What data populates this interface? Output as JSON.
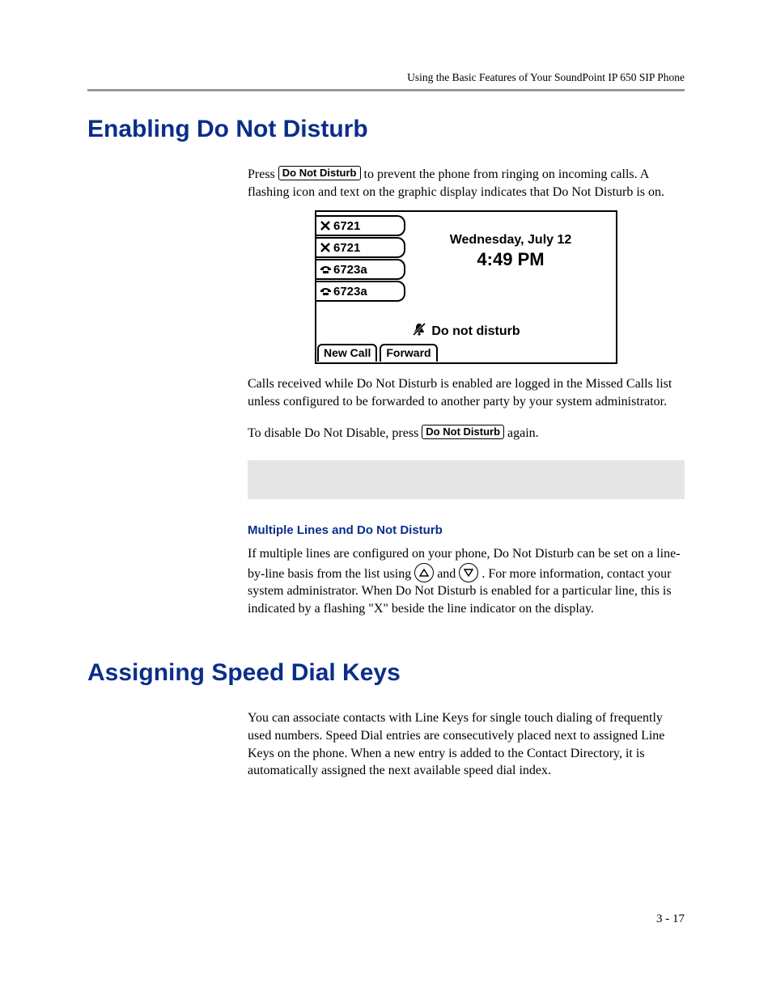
{
  "running_head": "Using the Basic Features of Your SoundPoint IP 650 SIP Phone",
  "section1": {
    "title": "Enabling Do Not Disturb",
    "p1a": "Press ",
    "key1": "Do Not Disturb",
    "p1b": " to prevent the phone from ringing on incoming calls. A flashing icon and text on the graphic display indicates that Do Not Disturb is on.",
    "p2": "Calls received while Do Not Disturb is enabled are logged in the Missed Calls list unless configured to be forwarded to another party by your system administrator.",
    "p3a": "To disable Do Not Disable, press ",
    "key2": "Do Not Disturb",
    "p3b": " again.",
    "subhead": "Multiple Lines and Do Not Disturb",
    "p4a": "If multiple lines are configured on your phone, Do Not Disturb can be set on a line-by-line basis from the list using ",
    "p4b": " and ",
    "p4c": ". For more information, contact your system administrator. When Do Not Disturb is enabled for a particular line, this is indicated by a flashing \"X\" beside the line indicator on the display."
  },
  "screen": {
    "lines": [
      {
        "icon": "x",
        "label": "6721"
      },
      {
        "icon": "x",
        "label": "6721"
      },
      {
        "icon": "phone",
        "label": "6723a"
      },
      {
        "icon": "phone",
        "label": "6723a"
      }
    ],
    "date": "Wednesday, July 12",
    "time": "4:49 PM",
    "status": "Do not disturb",
    "softkeys": [
      "New Call",
      "Forward"
    ]
  },
  "section2": {
    "title": "Assigning Speed Dial Keys",
    "p1": "You can associate contacts with Line Keys for single touch dialing of frequently used numbers. Speed Dial entries are consecutively placed next to assigned Line Keys on the phone. When a new entry is added to the Contact Directory, it is automatically assigned the next available speed dial index."
  },
  "page_num": "3 - 17"
}
